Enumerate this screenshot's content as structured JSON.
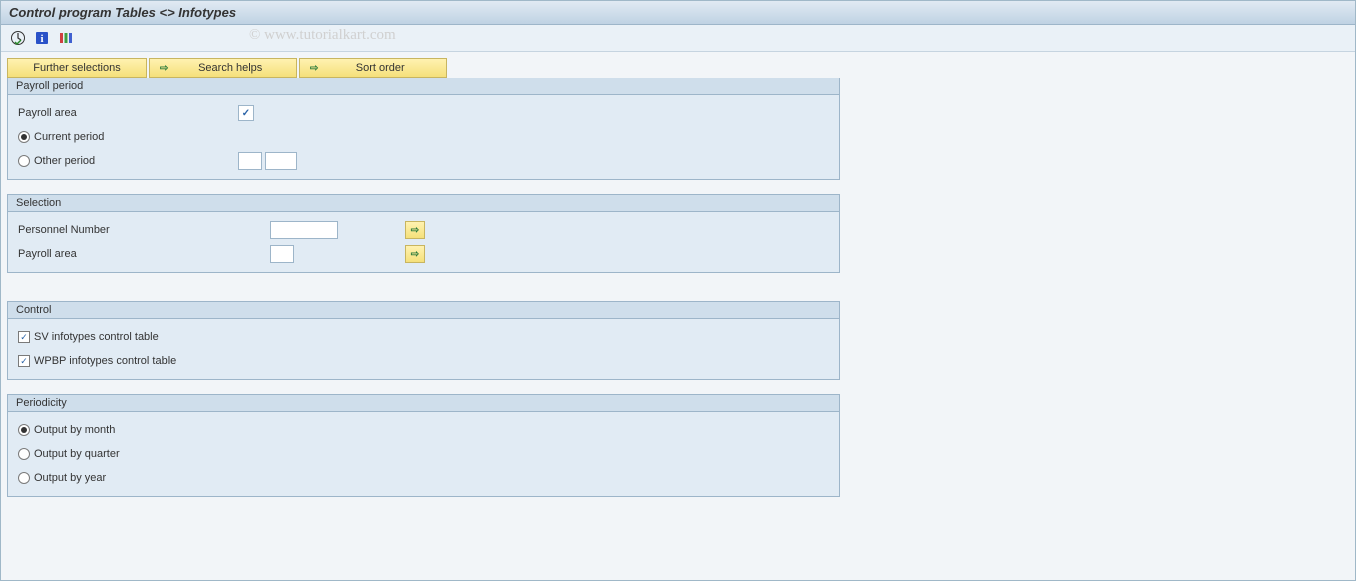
{
  "title": "Control program Tables <> Infotypes",
  "watermark": "© www.tutorialkart.com",
  "toolbar": {
    "icons": [
      "clock-check-icon",
      "info-icon",
      "columns-icon"
    ]
  },
  "buttons": {
    "further_selections": "Further selections",
    "search_helps": "Search helps",
    "sort_order": "Sort order"
  },
  "groups": {
    "payroll_period": {
      "title": "Payroll period",
      "payroll_area_label": "Payroll area",
      "current_period": "Current period",
      "other_period": "Other period"
    },
    "selection": {
      "title": "Selection",
      "personnel_number": "Personnel Number",
      "payroll_area": "Payroll area"
    },
    "control": {
      "title": "Control",
      "sv_label": "SV infotypes control table",
      "wpbp_label": "WPBP infotypes control table"
    },
    "periodicity": {
      "title": "Periodicity",
      "month": "Output by month",
      "quarter": "Output by quarter",
      "year": "Output by year"
    }
  }
}
